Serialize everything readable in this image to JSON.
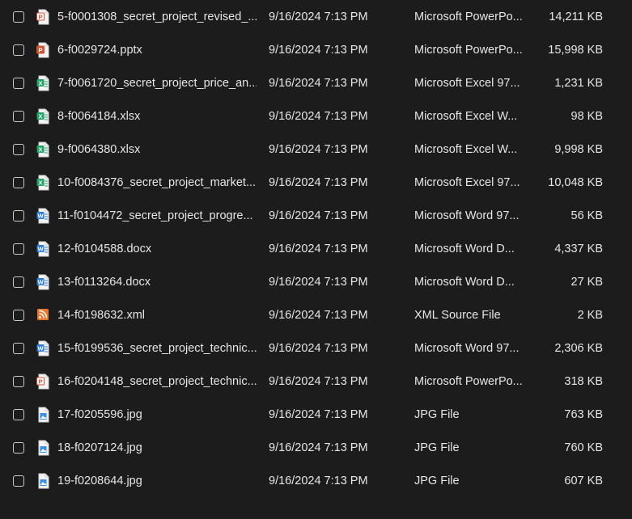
{
  "files": [
    {
      "name": "5-f0001308_secret_project_revised_...",
      "date": "9/16/2024 7:13 PM",
      "type": "Microsoft PowerPo...",
      "size": "14,211 KB",
      "icon": "pptx-icon",
      "kind": "pptx"
    },
    {
      "name": "6-f0029724.pptx",
      "date": "9/16/2024 7:13 PM",
      "type": "Microsoft PowerPo...",
      "size": "15,998 KB",
      "icon": "pptx-icon",
      "kind": "pptx-solid"
    },
    {
      "name": "7-f0061720_secret_project_price_an...",
      "date": "9/16/2024 7:13 PM",
      "type": "Microsoft Excel 97...",
      "size": "1,231 KB",
      "icon": "xlsx-icon",
      "kind": "xls"
    },
    {
      "name": "8-f0064184.xlsx",
      "date": "9/16/2024 7:13 PM",
      "type": "Microsoft Excel W...",
      "size": "98 KB",
      "icon": "xlsx-icon",
      "kind": "xlsx"
    },
    {
      "name": "9-f0064380.xlsx",
      "date": "9/16/2024 7:13 PM",
      "type": "Microsoft Excel W...",
      "size": "9,998 KB",
      "icon": "xlsx-icon",
      "kind": "xlsx"
    },
    {
      "name": "10-f0084376_secret_project_market...",
      "date": "9/16/2024 7:13 PM",
      "type": "Microsoft Excel 97...",
      "size": "10,048 KB",
      "icon": "xlsx-icon",
      "kind": "xls"
    },
    {
      "name": "11-f0104472_secret_project_progre...",
      "date": "9/16/2024 7:13 PM",
      "type": "Microsoft Word 97...",
      "size": "56 KB",
      "icon": "docx-icon",
      "kind": "doc"
    },
    {
      "name": "12-f0104588.docx",
      "date": "9/16/2024 7:13 PM",
      "type": "Microsoft Word D...",
      "size": "4,337 KB",
      "icon": "docx-icon",
      "kind": "docx"
    },
    {
      "name": "13-f0113264.docx",
      "date": "9/16/2024 7:13 PM",
      "type": "Microsoft Word D...",
      "size": "27 KB",
      "icon": "docx-icon",
      "kind": "docx"
    },
    {
      "name": "14-f0198632.xml",
      "date": "9/16/2024 7:13 PM",
      "type": "XML Source File",
      "size": "2 KB",
      "icon": "xml-icon",
      "kind": "xml"
    },
    {
      "name": "15-f0199536_secret_project_technic...",
      "date": "9/16/2024 7:13 PM",
      "type": "Microsoft Word 97...",
      "size": "2,306 KB",
      "icon": "docx-icon",
      "kind": "doc"
    },
    {
      "name": "16-f0204148_secret_project_technic...",
      "date": "9/16/2024 7:13 PM",
      "type": "Microsoft PowerPo...",
      "size": "318 KB",
      "icon": "pptx-icon",
      "kind": "pptx"
    },
    {
      "name": "17-f0205596.jpg",
      "date": "9/16/2024 7:13 PM",
      "type": "JPG File",
      "size": "763 KB",
      "icon": "jpg-icon",
      "kind": "jpg"
    },
    {
      "name": "18-f0207124.jpg",
      "date": "9/16/2024 7:13 PM",
      "type": "JPG File",
      "size": "760 KB",
      "icon": "jpg-icon",
      "kind": "jpg"
    },
    {
      "name": "19-f0208644.jpg",
      "date": "9/16/2024 7:13 PM",
      "type": "JPG File",
      "size": "607 KB",
      "icon": "jpg-icon",
      "kind": "jpg"
    }
  ],
  "colors": {
    "background": "#1c1c1c",
    "text": "#e6e6e6",
    "powerpoint": "#d35230",
    "excel": "#21a366",
    "word": "#2b7cd3",
    "xml": "#e8772e",
    "jpg": "#3a8ee6"
  }
}
